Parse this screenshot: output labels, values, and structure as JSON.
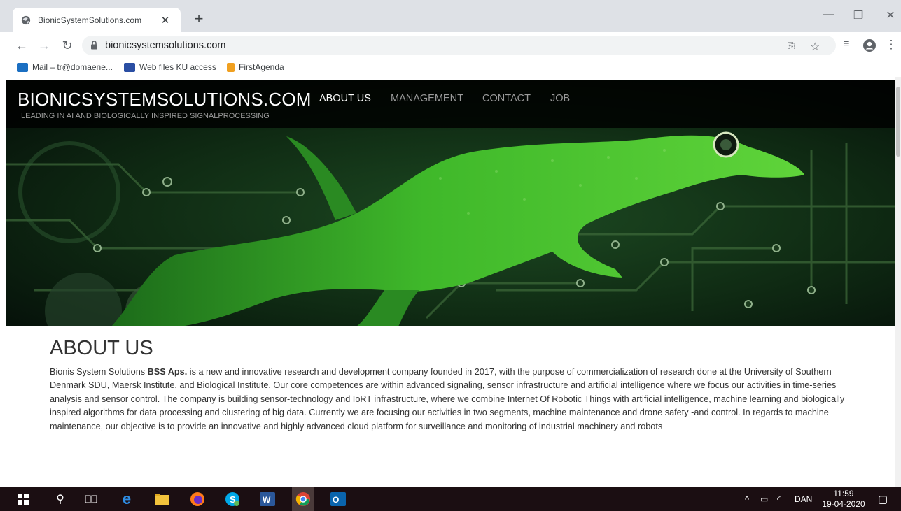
{
  "browser": {
    "tab_title": "BionicSystemSolutions.com",
    "url": "bionicsystemsolutions.com",
    "bookmarks": [
      {
        "label": "Mail – tr@domaene...",
        "color": "#1b6fc2"
      },
      {
        "label": "Web files KU access",
        "color": "#2a4ea3"
      },
      {
        "label": "FirstAgenda",
        "color": "#f0a020"
      }
    ]
  },
  "site": {
    "brand": "BIONICSYSTEMSOLUTIONS.COM",
    "tagline": "LEADING IN AI AND BIOLOGICALLY INSPIRED SIGNALPROCESSING",
    "nav": [
      "ABOUT US",
      "MANAGEMENT",
      "CONTACT",
      "JOB"
    ],
    "active_nav": "ABOUT US"
  },
  "about": {
    "heading": "ABOUT US",
    "intro": "Bionis System Solutions ",
    "company": "BSS Aps.",
    "body": " is a new and innovative research and development company founded in 2017, with the purpose of commercialization of research done at the University of Southern Denmark SDU, Maersk Institute, and Biological Institute. Our core competences are within advanced signaling, sensor infrastructure and artificial intelligence where we focus our activities in time-series analysis and sensor control. The company is building sensor-technology and IoRT infrastructure, where we combine Internet Of Robotic Things with artificial intelligence, machine learning and biologically inspired algorithms for data processing and clustering of big data. Currently we are focusing our activities in two segments, machine maintenance and drone safety -and control. In regards to machine maintenance, our objective is to provide an innovative and highly advanced cloud platform for surveillance and monitoring of industrial machinery and robots"
  },
  "taskbar": {
    "language": "DAN",
    "time": "11:59",
    "date": "19-04-2020"
  },
  "colors": {
    "lizard": "#3fb82a",
    "circuit": "#0e2a12"
  }
}
